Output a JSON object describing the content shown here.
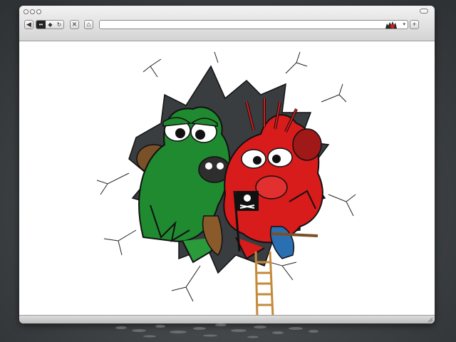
{
  "window": {
    "traffic_lights": [
      "close",
      "minimize",
      "zoom"
    ],
    "toolbar": {
      "buttons": [
        {
          "name": "back",
          "icon": "back-arrow-icon",
          "glyph": "◀"
        },
        {
          "name": "stop",
          "icon": "close-x-icon",
          "glyph": "✕"
        },
        {
          "name": "home",
          "icon": "home-icon",
          "glyph": "⌂"
        },
        {
          "name": "add-bookmark",
          "icon": "plus-icon",
          "glyph": "+"
        }
      ],
      "nav_glyphs": {
        "forward": "◆",
        "reload": "↻"
      }
    },
    "address_bar": {
      "value": "",
      "placeholder": "",
      "dropdown_glyph": "▾"
    }
  },
  "content": {
    "artwork": "monster-gang-illustration",
    "colors": {
      "green_monster": "#1f8a2f",
      "red_monster": "#d81b1b",
      "background": "#ffffff",
      "hole_dark": "#3a3d40"
    }
  }
}
